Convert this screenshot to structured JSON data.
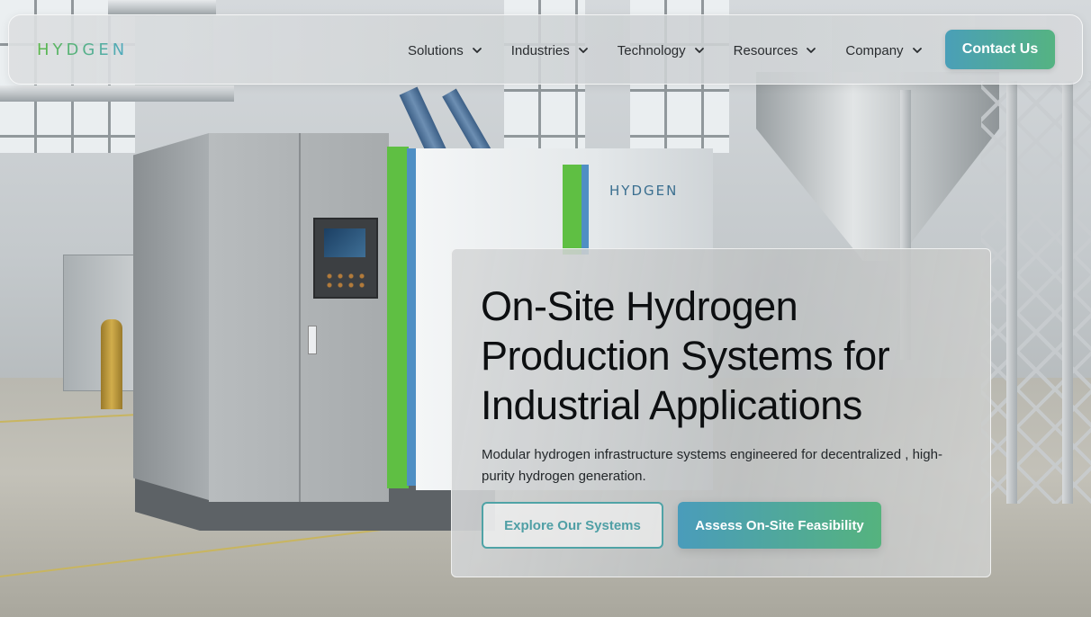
{
  "header": {
    "logo_text": "HYDGEN",
    "nav": [
      {
        "label": "Solutions"
      },
      {
        "label": "Industries"
      },
      {
        "label": "Technology"
      },
      {
        "label": "Resources"
      },
      {
        "label": "Company"
      }
    ],
    "contact_label": "Contact Us"
  },
  "hero": {
    "title": "On-Site Hydrogen Production Systems for Industrial Applications",
    "subtitle": "Modular hydrogen infrastructure systems engineered for decentralized , high-purity hydrogen generation.",
    "primary_cta": "Explore Our Systems",
    "secondary_cta": "Assess On-Site Feasibility"
  },
  "scene": {
    "machine_logo": "HYDGEN"
  },
  "colors": {
    "accent_blue": "#4a9fb8",
    "accent_green": "#55b382",
    "text_dark": "#0d0f11"
  },
  "icons": {
    "nav_dropdown": "chevron-down-icon"
  }
}
